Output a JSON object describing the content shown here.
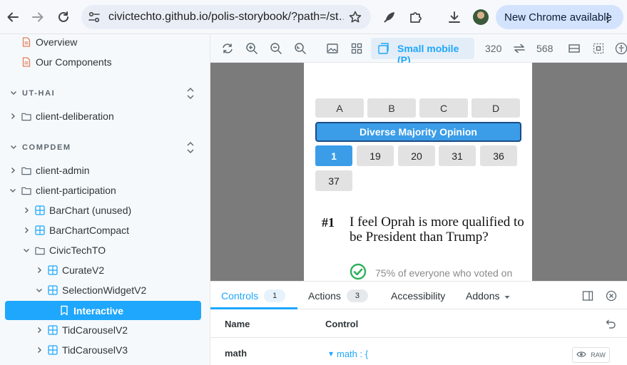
{
  "browser": {
    "url": "civictechto.github.io/polis-storybook/?path=/st…",
    "update_label": "New Chrome available"
  },
  "sidebar": {
    "top_items": [
      {
        "label": "Overview"
      },
      {
        "label": "Our Components"
      }
    ],
    "sections": [
      {
        "label": "UT-HAI",
        "items": [
          {
            "label": "client-deliberation"
          }
        ]
      },
      {
        "label": "COMPDEM",
        "items": [
          {
            "label": "client-admin"
          },
          {
            "label": "client-participation"
          },
          {
            "label": "BarChart (unused)"
          },
          {
            "label": "BarChartCompact"
          },
          {
            "label": "CivicTechTO"
          },
          {
            "label": "CurateV2"
          },
          {
            "label": "SelectionWidgetV2"
          },
          {
            "label": "Interactive"
          },
          {
            "label": "TidCarouselV2"
          },
          {
            "label": "TidCarouselV3"
          }
        ]
      }
    ]
  },
  "preview_toolbar": {
    "viewport_label": "Small mobile (P)",
    "width": "320",
    "height": "568"
  },
  "story": {
    "group_tabs": [
      "A",
      "B",
      "C",
      "D"
    ],
    "majority_label": "Diverse Majority Opinion",
    "statement_ids": [
      "1",
      "19",
      "20",
      "31",
      "36",
      "37"
    ],
    "active_statement": "1",
    "statement_number": "#1",
    "statement_text": "I feel Oprah is more qualified to be President than Trump?",
    "agree_text": "75% of everyone who voted on"
  },
  "addons": {
    "tabs": [
      {
        "label": "Controls",
        "badge": "1"
      },
      {
        "label": "Actions",
        "badge": "3"
      },
      {
        "label": "Accessibility",
        "badge": ""
      },
      {
        "label": "Addons",
        "badge": ""
      }
    ],
    "columns": {
      "name": "Name",
      "control": "Control"
    },
    "rows": [
      {
        "name": "math",
        "control": "math : {"
      }
    ],
    "raw_label": "RAW"
  },
  "colors": {
    "accent": "#1ea7fd",
    "story_blue": "#3b9de8",
    "agree_green": "#2eb05c"
  }
}
